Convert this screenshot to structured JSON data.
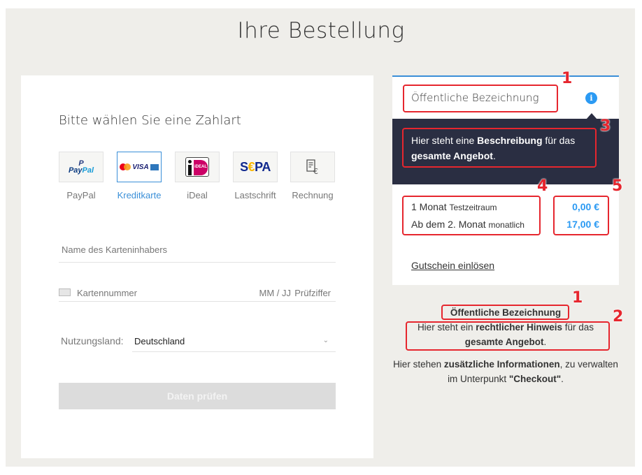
{
  "page": {
    "title": "Ihre Bestellung"
  },
  "payment": {
    "heading": "Bitte wählen Sie eine Zahlart",
    "methods": [
      {
        "label": "PayPal",
        "icon": "paypal-logo",
        "logo_text_1": "Pay",
        "logo_text_2": "Pal"
      },
      {
        "label": "Kreditkarte",
        "icon": "credit-card-logos",
        "logo_text": "VISA",
        "selected": true
      },
      {
        "label": "iDeal",
        "icon": "ideal-logo",
        "logo_text": "iDEAL"
      },
      {
        "label": "Lastschrift",
        "icon": "sepa-logo",
        "logo_text_1": "S",
        "logo_text_2": "€",
        "logo_text_3": "PA"
      },
      {
        "label": "Rechnung",
        "icon": "invoice-icon"
      }
    ],
    "fields": {
      "holder_placeholder": "Name des Karteninhabers",
      "card_number_placeholder": "Kartennummer",
      "expiry_placeholder": "MM / JJ",
      "cvc_placeholder": "Prüfziffer",
      "country_label": "Nutzungsland:",
      "country_value": "Deutschland"
    },
    "submit_label": "Daten prüfen",
    "colors": {
      "accent": "#3a8fd8",
      "button_disabled": "#dcdcdc"
    }
  },
  "offer": {
    "public_name": "Öffentliche Bezeichnung",
    "description": {
      "part1": "Hier steht eine ",
      "bold1": "Beschreibung",
      "part2": " für das ",
      "bold2": "gesamte Angebot",
      "part3": "."
    },
    "rows": [
      {
        "label": "1 Monat",
        "sub": "Testzeitraum",
        "price": "0,00 €"
      },
      {
        "label": "Ab dem 2. Monat",
        "sub": "monatlich",
        "price": "17,00 €"
      }
    ],
    "voucher_link": "Gutschein einlösen",
    "colors": {
      "price": "#2b9af3",
      "description_bg": "#2a2e42"
    }
  },
  "legal": {
    "title": "Öffentliche Bezeichnung",
    "hint": {
      "part1": "Hier steht ein ",
      "bold1": "rechtlicher Hinweis",
      "part2": " für das ",
      "bold2": "gesamte Angebot",
      "part3": "."
    },
    "extra": {
      "part1": "Hier stehen ",
      "bold1": "zusätzliche Informationen",
      "part2": ", zu verwalten im Unterpunkt ",
      "bold2": "\"Checkout\"",
      "part3": "."
    }
  },
  "annotations": {
    "numbers": [
      "1",
      "2",
      "3",
      "4",
      "5"
    ],
    "color": "#e6262e"
  }
}
